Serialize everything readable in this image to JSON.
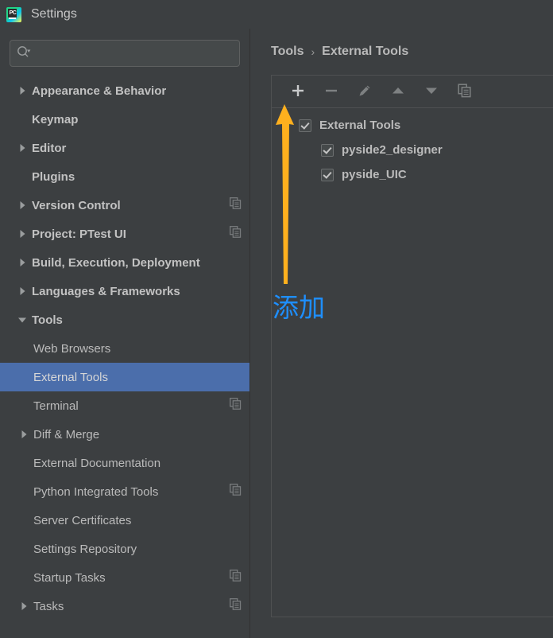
{
  "window": {
    "title": "Settings",
    "logo_icon": "pycharm-logo-icon",
    "logo_text": "PC"
  },
  "search": {
    "value": "",
    "placeholder": "",
    "icon": "search-icon"
  },
  "sidebar": {
    "items": [
      {
        "label": "Appearance & Behavior",
        "level": 0,
        "arrow": "collapsed",
        "copy_icon": false,
        "selected": false
      },
      {
        "label": "Keymap",
        "level": 0,
        "arrow": "none",
        "copy_icon": false,
        "selected": false
      },
      {
        "label": "Editor",
        "level": 0,
        "arrow": "collapsed",
        "copy_icon": false,
        "selected": false
      },
      {
        "label": "Plugins",
        "level": 0,
        "arrow": "none",
        "copy_icon": false,
        "selected": false
      },
      {
        "label": "Version Control",
        "level": 0,
        "arrow": "collapsed",
        "copy_icon": true,
        "selected": false
      },
      {
        "label": "Project: PTest UI",
        "level": 0,
        "arrow": "collapsed",
        "copy_icon": true,
        "selected": false
      },
      {
        "label": "Build, Execution, Deployment",
        "level": 0,
        "arrow": "collapsed",
        "copy_icon": false,
        "selected": false
      },
      {
        "label": "Languages & Frameworks",
        "level": 0,
        "arrow": "collapsed",
        "copy_icon": false,
        "selected": false
      },
      {
        "label": "Tools",
        "level": 0,
        "arrow": "expanded",
        "copy_icon": false,
        "selected": false
      },
      {
        "label": "Web Browsers",
        "level": 1,
        "arrow": "none",
        "copy_icon": false,
        "selected": false
      },
      {
        "label": "External Tools",
        "level": 1,
        "arrow": "none",
        "copy_icon": false,
        "selected": true
      },
      {
        "label": "Terminal",
        "level": 1,
        "arrow": "none",
        "copy_icon": true,
        "selected": false
      },
      {
        "label": "Diff & Merge",
        "level": 1,
        "arrow": "collapsed",
        "copy_icon": false,
        "selected": false
      },
      {
        "label": "External Documentation",
        "level": 1,
        "arrow": "none",
        "copy_icon": false,
        "selected": false
      },
      {
        "label": "Python Integrated Tools",
        "level": 1,
        "arrow": "none",
        "copy_icon": true,
        "selected": false
      },
      {
        "label": "Server Certificates",
        "level": 1,
        "arrow": "none",
        "copy_icon": false,
        "selected": false
      },
      {
        "label": "Settings Repository",
        "level": 1,
        "arrow": "none",
        "copy_icon": false,
        "selected": false
      },
      {
        "label": "Startup Tasks",
        "level": 1,
        "arrow": "none",
        "copy_icon": true,
        "selected": false
      },
      {
        "label": "Tasks",
        "level": 1,
        "arrow": "collapsed",
        "copy_icon": true,
        "selected": false
      }
    ]
  },
  "breadcrumb": {
    "parent": "Tools",
    "separator": "›",
    "current": "External Tools"
  },
  "toolbar": {
    "buttons": [
      {
        "icon": "add-icon",
        "label": "+",
        "enabled": true
      },
      {
        "icon": "remove-icon",
        "label": "−",
        "enabled": false
      },
      {
        "icon": "edit-pencil-icon",
        "label": "",
        "enabled": false
      },
      {
        "icon": "move-up-icon",
        "label": "",
        "enabled": false
      },
      {
        "icon": "move-down-icon",
        "label": "",
        "enabled": false
      },
      {
        "icon": "copy-icon",
        "label": "",
        "enabled": false
      }
    ]
  },
  "tools_tree": {
    "root": {
      "label": "External Tools",
      "checked": true
    },
    "children": [
      {
        "label": "pyside2_designer",
        "checked": true
      },
      {
        "label": "pyside_UIC",
        "checked": true
      }
    ]
  },
  "annotations": {
    "arrow": {
      "icon": "up-arrow-annotation-icon",
      "color": "#FFB01E"
    },
    "text": {
      "value": "添加",
      "color": "#1E8FFF"
    }
  },
  "colors": {
    "background": "#3C3F41",
    "selection": "#4B6EAB",
    "text": "#BBBBBB",
    "border": "#4F5152",
    "annotation_arrow": "#FFB01E",
    "annotation_text": "#1E8FFF"
  }
}
